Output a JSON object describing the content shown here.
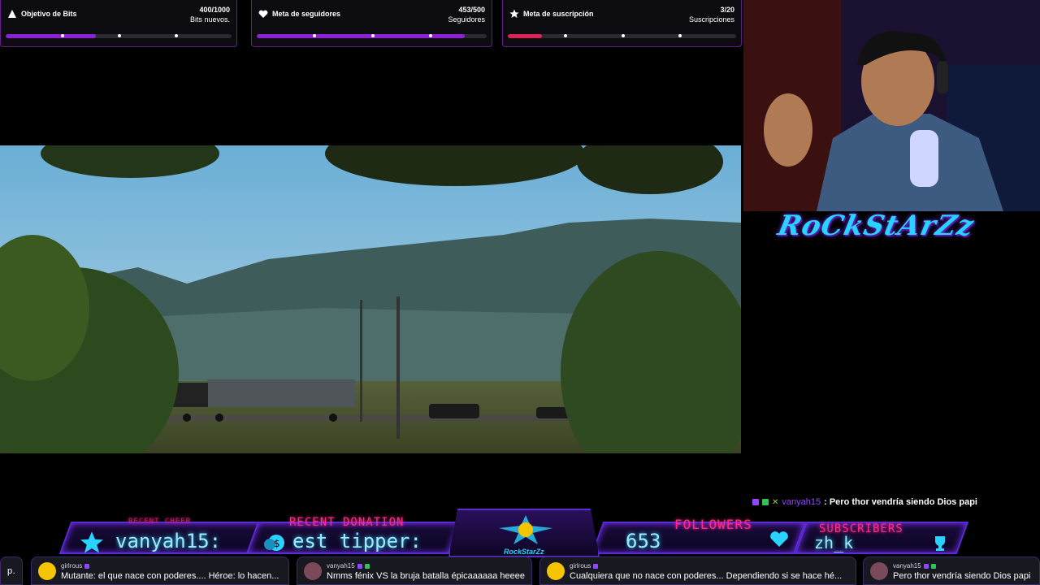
{
  "goals": [
    {
      "title": "Objetivo de Bits",
      "count": "400/1000",
      "unit": "Bits nuevos.",
      "progress": 0.4,
      "color": "#8f1fd6",
      "icon": "triangle-icon"
    },
    {
      "title": "Meta de seguidores",
      "count": "453/500",
      "unit": "Seguidores",
      "progress": 0.906,
      "color": "#8f1fd6",
      "icon": "heart-icon"
    },
    {
      "title": "Meta de suscripción",
      "count": "3/20",
      "unit": "Suscripciones",
      "progress": 0.15,
      "color": "#e0205a",
      "icon": "star-icon"
    }
  ],
  "channel_logo": "RoCkStArZz",
  "chat_overlay": {
    "user": "vanyah15",
    "message": ": Pero thor vendría siendo Dios papi"
  },
  "banner": {
    "recent_cheer_label": "RECENT CHEER",
    "recent_cheer_value": "vanyah15:",
    "recent_donation_label": "RECENT DONATION",
    "recent_donation_value": "est tipper:",
    "center_logo": "RockStarZz",
    "followers_label": "FOLLOWERS",
    "followers_value": "653",
    "subscribers_label": "SUBSCRIBERS",
    "subscribers_value": "zh_k"
  },
  "ticker": [
    {
      "user": "",
      "message": "p...",
      "avatar_color": "#333"
    },
    {
      "user": "girlrous",
      "message": "Mutante: el que nace con poderes.... Héroe: lo hacen...",
      "avatar_color": "#f5c400"
    },
    {
      "user": "vanyah15",
      "message": "Nmms fénix VS la bruja batalla épicaaaaaa heeee",
      "avatar_color": "#7a4a5a"
    },
    {
      "user": "girlrous",
      "message": "Cualquiera que no nace con poderes... Dependiendo si se hace hé...",
      "avatar_color": "#f5c400"
    },
    {
      "user": "vanyah15",
      "message": "Pero thor vendría siendo Dios papi",
      "avatar_color": "#7a4a5a"
    }
  ]
}
